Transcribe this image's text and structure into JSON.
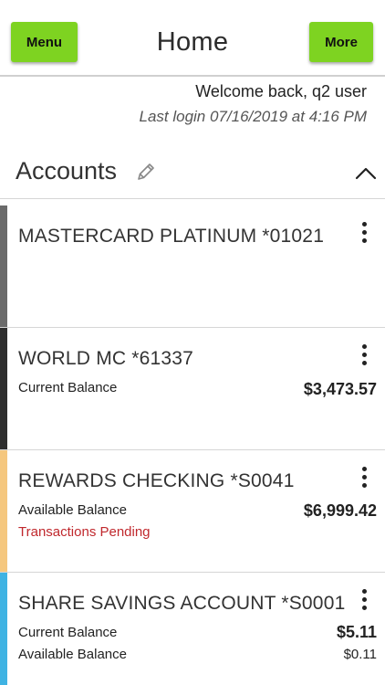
{
  "header": {
    "menu_label": "Menu",
    "title": "Home",
    "more_label": "More",
    "accent_color": "#7ed321"
  },
  "welcome": {
    "message": "Welcome back, q2 user",
    "last_login": "Last login 07/16/2019 at 4:16 PM"
  },
  "accounts": {
    "title": "Accounts",
    "edit_icon": "pencil-icon",
    "collapse_icon": "chevron-up-icon",
    "items": [
      {
        "name": "MASTERCARD PLATINUM *01021",
        "stripe_color": "#6b6b6b"
      },
      {
        "name": "WORLD MC *61337",
        "stripe_color": "#2e2e2e",
        "balance_label": "Current Balance",
        "balance": "$3,473.57"
      },
      {
        "name": "REWARDS CHECKING *S0041",
        "stripe_color": "#f5c77e",
        "balance_label": "Available Balance",
        "balance": "$6,999.42",
        "status": "Transactions Pending",
        "status_color": "#c0282d"
      },
      {
        "name": "SHARE SAVINGS ACCOUNT *S0001",
        "stripe_color": "#3fb3e3",
        "balance_label": "Current Balance",
        "balance": "$5.11",
        "secondary_label": "Available Balance",
        "secondary_balance": "$0.11"
      }
    ]
  }
}
